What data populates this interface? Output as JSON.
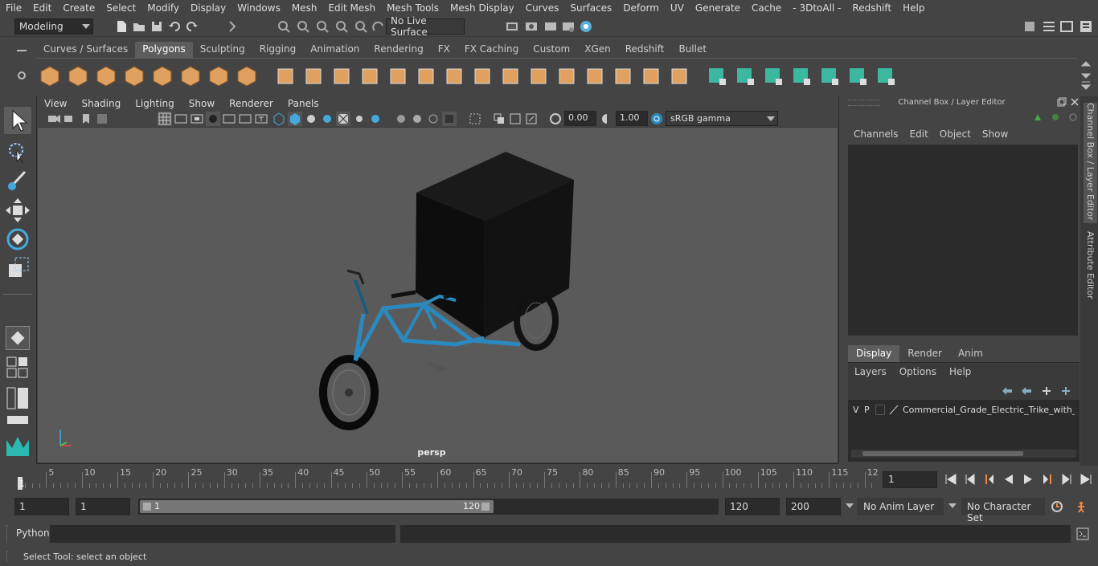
{
  "menubar": {
    "items": [
      "File",
      "Edit",
      "Create",
      "Select",
      "Modify",
      "Display",
      "Windows",
      "Mesh",
      "Edit Mesh",
      "Mesh Tools",
      "Mesh Display",
      "Curves",
      "Surfaces",
      "Deform",
      "UV",
      "Generate",
      "Cache",
      "- 3DtoAll -",
      "Redshift",
      "Help"
    ]
  },
  "statusline": {
    "mode": "Modeling",
    "live_surface": "No Live Surface"
  },
  "shelf": {
    "tabs": [
      "Curves / Surfaces",
      "Polygons",
      "Sculpting",
      "Rigging",
      "Animation",
      "Rendering",
      "FX",
      "FX Caching",
      "Custom",
      "XGen",
      "Redshift",
      "Bullet"
    ],
    "active_tab": "Polygons"
  },
  "viewport": {
    "menu": [
      "View",
      "Shading",
      "Lighting",
      "Show",
      "Renderer",
      "Panels"
    ],
    "exposure": "0.00",
    "gamma": "1.00",
    "colorspace": "sRGB gamma",
    "camera_label": "persp"
  },
  "channelbox": {
    "title": "Channel Box / Layer Editor",
    "menu": [
      "Channels",
      "Edit",
      "Object",
      "Show"
    ],
    "tabs": [
      "Display",
      "Render",
      "Anim"
    ],
    "active_tab": "Display",
    "layer_menu": [
      "Layers",
      "Options",
      "Help"
    ],
    "layer": {
      "v": "V",
      "p": "P",
      "name": "Commercial_Grade_Electric_Trike_with_Car"
    }
  },
  "sidetabs": [
    "Channel Box / Layer Editor",
    "Attribute Editor"
  ],
  "timeline": {
    "ticks": [
      "5",
      "10",
      "15",
      "20",
      "25",
      "30",
      "35",
      "40",
      "45",
      "50",
      "55",
      "60",
      "65",
      "70",
      "75",
      "80",
      "85",
      "90",
      "95",
      "100",
      "105",
      "110",
      "115",
      "12"
    ],
    "current": "1",
    "current_frame": "1"
  },
  "range": {
    "start": "1",
    "playback_start": "1",
    "slider_start": "1",
    "slider_end": "120",
    "end": "120",
    "anim_end": "200",
    "anim_layer": "No Anim Layer",
    "character_set": "No Character Set"
  },
  "cmdline": {
    "label": "Python"
  },
  "help": {
    "text": "Select Tool: select an object"
  },
  "colors": {
    "accent": "#5d5d5d",
    "shelf_orange": "#e0a060",
    "shelf_teal": "#3cb8a0",
    "frame_blue": "#2a8ac0"
  }
}
